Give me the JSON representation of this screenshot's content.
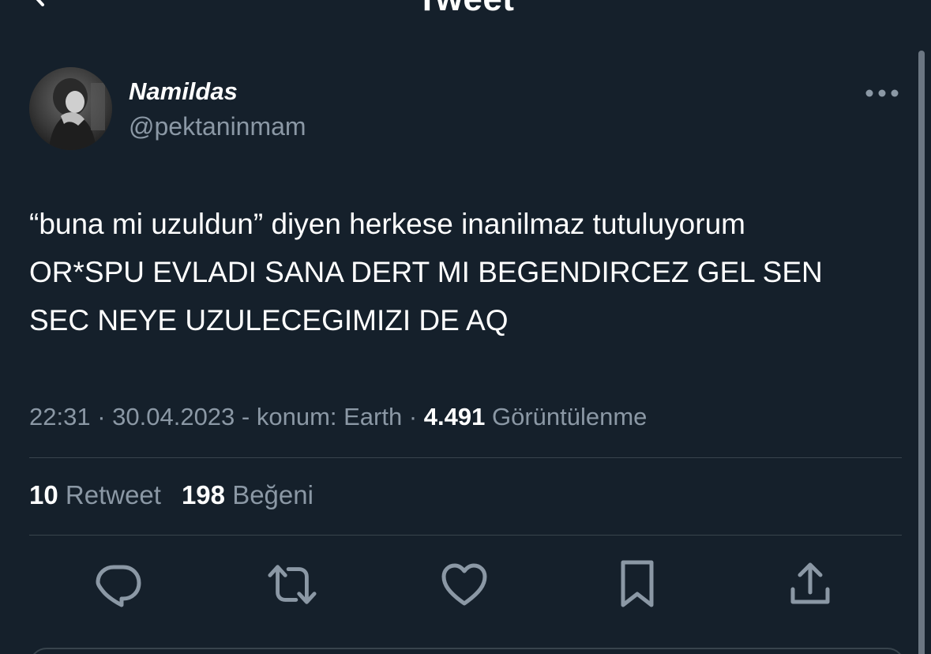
{
  "header": {
    "title": "Tweet",
    "back_icon": "chevron-left-icon"
  },
  "author": {
    "display_name": "Namildas",
    "handle": "@pektaninmam",
    "avatar_icon": "avatar-photo"
  },
  "tweet": {
    "text": "“buna mi uzuldun” diyen herkese inanilmaz tutuluyorum\nOR*SPU EVLADI SANA DERT MI BEGENDIRCEZ GEL SEN\nSEC NEYE UZULECEGIMIZI DE AQ"
  },
  "meta": {
    "time": "22:31",
    "sep1": " · ",
    "date": "30.04.2023",
    "location": " - konum: Earth",
    "sep2": " · ",
    "views_count": "4.491",
    "views_label": " Görüntülenme"
  },
  "stats": {
    "retweet_count": "10",
    "retweet_label": "Retweet",
    "like_count": "198",
    "like_label": "Beğeni"
  },
  "actions": {
    "reply_icon": "reply-icon",
    "retweet_icon": "retweet-icon",
    "like_icon": "heart-icon",
    "bookmark_icon": "bookmark-icon",
    "share_icon": "share-icon"
  },
  "colors": {
    "background": "#15202b",
    "text_primary": "#ffffff",
    "text_secondary": "#8b98a5",
    "divider": "#38444d"
  }
}
